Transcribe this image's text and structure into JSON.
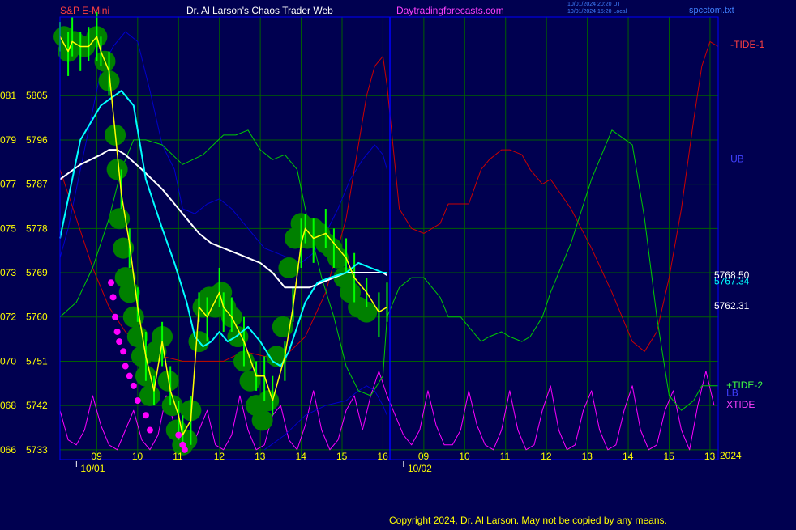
{
  "header": {
    "symbol": "S&P E-Mini",
    "site_title": "Dr. Al Larson's Chaos Trader Web",
    "site_url": "Daytradingforecasts.com",
    "timestamp_ut": "10/01/2024 20:20 UT",
    "timestamp_local": "10/01/2024 15:20 Local",
    "filename": "spcctom.txt"
  },
  "footer": {
    "copyright": "Copyright 2024, Dr. Al Larson. May not be copied by any means."
  },
  "colors": {
    "background": "#000050",
    "frame": "#0000ff",
    "grid": "#006000",
    "price_bar": "#00ff00",
    "event_bubble": "#008000",
    "fast_ma": "#ffff00",
    "medium_ma": "#00ffff",
    "slow_ma": "#ffffff",
    "tide1": "#cc0000",
    "tide2": "#00cc00",
    "ub": "#0000cc",
    "xtide": "#ff00ff",
    "axis_text": "#ffff00"
  },
  "chart_data": {
    "type": "line",
    "title": "S&P E-Mini",
    "y_labels": [
      {
        "left": "081",
        "price": "5805"
      },
      {
        "left": "079",
        "price": "5796"
      },
      {
        "left": "077",
        "price": "5787"
      },
      {
        "left": "075",
        "price": "5778"
      },
      {
        "left": "073",
        "price": "5769"
      },
      {
        "left": "072",
        "price": "5760"
      },
      {
        "left": "070",
        "price": "5751"
      },
      {
        "left": "068",
        "price": "5742"
      },
      {
        "left": "066",
        "price": "5733"
      }
    ],
    "ylim": [
      5731,
      5821
    ],
    "x_ticks": [
      "09",
      "10",
      "11",
      "12",
      "13",
      "14",
      "15",
      "16",
      "09",
      "10",
      "11",
      "12",
      "13",
      "14",
      "15",
      "13"
    ],
    "x_tick_positions": [
      8.9,
      9.9,
      10.9,
      11.9,
      12.9,
      13.9,
      14.9,
      15.9,
      16.9,
      17.9,
      18.9,
      19.9,
      20.9,
      21.9,
      22.9,
      23.9
    ],
    "xlim": [
      8,
      24.1
    ],
    "date_labels": [
      {
        "label": "10/01",
        "x": 8.8
      },
      {
        "label": "10/02",
        "x": 16.8
      }
    ],
    "year_label": "2024",
    "right_labels": [
      {
        "text": "-TIDE-1",
        "color": "#ff4040",
        "x": 24.4,
        "y": 5815.4
      },
      {
        "text": "UB",
        "color": "#4040ff",
        "x": 24.4,
        "y": 5792.1
      },
      {
        "text": "5768.50",
        "color": "#ffffff",
        "x": 24.0,
        "y": 5768.5
      },
      {
        "text": "5767.34",
        "color": "#00ffff",
        "x": 24.0,
        "y": 5767.3
      },
      {
        "text": "5762.31",
        "color": "#ffffff",
        "x": 24.0,
        "y": 5762.3
      },
      {
        "text": "+TIDE-2",
        "color": "#40ff40",
        "x": 24.3,
        "y": 5746.1
      },
      {
        "text": "LB",
        "color": "#4040ff",
        "x": 24.3,
        "y": 5744.6
      },
      {
        "text": "XTIDE",
        "color": "#ff40ff",
        "x": 24.3,
        "y": 5742.2
      }
    ],
    "series": [
      {
        "name": "price",
        "color": "#ffff00",
        "x": [
          8.0,
          8.2,
          8.3,
          8.5,
          8.7,
          8.9,
          9.0,
          9.2,
          9.5,
          9.7,
          9.9,
          10.1,
          10.3,
          10.5,
          10.7,
          10.9,
          11.0,
          11.2,
          11.4,
          11.6,
          11.9,
          12.0,
          12.2,
          12.5,
          12.8,
          13.0,
          13.2,
          13.5,
          13.7,
          13.9,
          14.0,
          14.2,
          14.5,
          14.7,
          15.0,
          15.2,
          15.5,
          15.8,
          16.0
        ],
        "values": [
          5817,
          5814,
          5816,
          5815,
          5815,
          5817,
          5814,
          5810,
          5785,
          5775,
          5762,
          5752,
          5745,
          5755,
          5745,
          5740,
          5736,
          5739,
          5762,
          5760,
          5765,
          5762,
          5760,
          5755,
          5748,
          5748,
          5743,
          5752,
          5762,
          5775,
          5778,
          5776,
          5777,
          5775,
          5772,
          5768,
          5765,
          5761,
          5762
        ]
      },
      {
        "name": "medium",
        "color": "#00ffff",
        "x": [
          8.0,
          8.5,
          9.0,
          9.5,
          9.8,
          10.1,
          10.5,
          10.8,
          11.1,
          11.3,
          11.5,
          11.7,
          11.9,
          12.1,
          12.3,
          12.6,
          12.9,
          13.2,
          13.4,
          13.6,
          13.8,
          14.0,
          14.3,
          14.6,
          15.0,
          15.3,
          15.6,
          15.9,
          16.0
        ],
        "values": [
          5776,
          5796,
          5803,
          5806,
          5803,
          5788,
          5778,
          5771,
          5763,
          5756,
          5754,
          5755,
          5757,
          5755,
          5756,
          5758,
          5755,
          5751,
          5750,
          5753,
          5758,
          5763,
          5767,
          5768,
          5769,
          5771,
          5770,
          5769,
          5769
        ]
      },
      {
        "name": "slow",
        "color": "#ffffff",
        "x": [
          8.0,
          8.5,
          9.0,
          9.2,
          9.4,
          9.6,
          10.0,
          10.5,
          11.0,
          11.2,
          11.4,
          11.7,
          12.0,
          12.3,
          12.6,
          12.9,
          13.2,
          13.5,
          13.8,
          14.1,
          14.4,
          14.7,
          15.0,
          15.3,
          15.6,
          15.9,
          16.0
        ],
        "values": [
          5788,
          5791,
          5793,
          5794,
          5794,
          5793,
          5790,
          5786,
          5781,
          5779,
          5777,
          5775,
          5774,
          5773,
          5772,
          5771,
          5769,
          5766,
          5766,
          5766,
          5767,
          5768,
          5769,
          5769,
          5769,
          5769,
          5768.5
        ]
      },
      {
        "name": "tide1",
        "color": "#cc0000",
        "x": [
          8.0,
          8.4,
          8.8,
          9.2,
          9.6,
          10.0,
          10.5,
          11.0,
          11.5,
          12.0,
          12.5,
          13.0,
          13.5,
          14.0,
          14.5,
          15.0,
          15.3,
          15.5,
          15.7,
          15.9,
          16.0,
          16.3,
          16.6,
          16.9,
          17.1,
          17.3,
          17.5,
          17.8,
          18.0,
          18.3,
          18.5,
          18.8,
          19.0,
          19.3,
          19.5,
          19.8,
          20.0,
          20.5,
          21.0,
          21.5,
          22.0,
          22.3,
          22.6,
          22.9,
          23.2,
          23.5,
          23.7,
          23.9,
          24.1
        ],
        "values": [
          5790,
          5780,
          5770,
          5762,
          5757,
          5754,
          5752,
          5751,
          5751,
          5751,
          5753,
          5752,
          5752,
          5756,
          5765,
          5780,
          5795,
          5805,
          5811,
          5813,
          5807,
          5782,
          5778,
          5777,
          5778,
          5779,
          5783,
          5783,
          5783,
          5790,
          5792,
          5794,
          5794,
          5793,
          5790,
          5787,
          5788,
          5782,
          5774,
          5765,
          5755,
          5753,
          5757,
          5768,
          5782,
          5800,
          5811,
          5816,
          5815
        ]
      },
      {
        "name": "tide2",
        "color": "#00cc00",
        "x": [
          8.0,
          8.4,
          8.8,
          9.2,
          9.5,
          9.8,
          10.1,
          10.5,
          11.0,
          11.5,
          12.0,
          12.3,
          12.6,
          12.9,
          13.2,
          13.5,
          13.8,
          14.1,
          14.4,
          14.7,
          15.0,
          15.3,
          15.6,
          15.9,
          16.0,
          16.3,
          16.6,
          16.9,
          17.1,
          17.3,
          17.5,
          17.8,
          18.0,
          18.3,
          18.5,
          18.8,
          19.0,
          19.3,
          19.5,
          19.8,
          20.0,
          20.5,
          21.0,
          21.5,
          22.0,
          22.3,
          22.6,
          22.9,
          23.2,
          23.5,
          23.7,
          23.9,
          24.1
        ],
        "values": [
          5760,
          5763,
          5770,
          5780,
          5790,
          5796,
          5796,
          5795,
          5791,
          5793,
          5797,
          5797,
          5798,
          5794,
          5792,
          5793,
          5790,
          5778,
          5768,
          5760,
          5750,
          5745,
          5744,
          5748,
          5760,
          5766,
          5768,
          5768,
          5766,
          5764,
          5760,
          5760,
          5758,
          5755,
          5756,
          5757,
          5756,
          5755,
          5756,
          5760,
          5765,
          5775,
          5788,
          5798,
          5795,
          5780,
          5760,
          5744,
          5741,
          5743,
          5746,
          5746,
          5746
        ]
      },
      {
        "name": "ub",
        "color": "#0000cc",
        "x": [
          8.0,
          8.2,
          8.5,
          8.8,
          9.0,
          9.3,
          9.6,
          9.9,
          10.2,
          10.5,
          10.8,
          11.0,
          11.3,
          11.6,
          11.9,
          12.2,
          12.5,
          12.8,
          13.0,
          13.3,
          13.6,
          13.9,
          14.2,
          14.5,
          14.8,
          15.1,
          15.4,
          15.7,
          15.9,
          16.0
        ],
        "values": [
          5772,
          5778,
          5790,
          5802,
          5810,
          5815,
          5818,
          5816,
          5806,
          5795,
          5790,
          5782,
          5781,
          5783,
          5784,
          5782,
          5779,
          5776,
          5774,
          5773,
          5772,
          5771,
          5773,
          5777,
          5782,
          5788,
          5792,
          5795,
          5793,
          5790
        ]
      },
      {
        "name": "lb",
        "color": "#0000cc",
        "x": [
          13.0,
          13.5,
          14.0,
          14.5,
          15.0,
          15.3,
          15.5,
          15.7,
          15.9,
          16.0
        ],
        "values": [
          5733,
          5736,
          5740,
          5742,
          5743,
          5745,
          5746,
          5745,
          5742,
          5740
        ]
      },
      {
        "name": "xtide",
        "color": "#ff00ff",
        "x": [
          8.0,
          8.2,
          8.4,
          8.6,
          8.8,
          9.0,
          9.2,
          9.4,
          9.6,
          9.8,
          10.0,
          10.2,
          10.4,
          10.6,
          10.8,
          11.0,
          11.2,
          11.4,
          11.6,
          11.8,
          12.0,
          12.2,
          12.4,
          12.6,
          12.8,
          13.0,
          13.2,
          13.4,
          13.6,
          13.8,
          14.0,
          14.2,
          14.4,
          14.6,
          14.8,
          15.0,
          15.2,
          15.4,
          15.6,
          15.8,
          16.0,
          16.2,
          16.4,
          16.6,
          16.8,
          17.0,
          17.2,
          17.4,
          17.6,
          17.8,
          18.0,
          18.2,
          18.4,
          18.6,
          18.8,
          19.0,
          19.2,
          19.4,
          19.6,
          19.8,
          20.0,
          20.2,
          20.4,
          20.6,
          20.8,
          21.0,
          21.2,
          21.4,
          21.6,
          21.8,
          22.0,
          22.2,
          22.4,
          22.6,
          22.8,
          23.0,
          23.2,
          23.4,
          23.6,
          23.8,
          24.0
        ],
        "values": [
          5741,
          5735,
          5734,
          5737,
          5744,
          5738,
          5734,
          5733,
          5737,
          5741,
          5735,
          5733,
          5736,
          5744,
          5738,
          5734,
          5733,
          5737,
          5741,
          5734,
          5733,
          5736,
          5744,
          5737,
          5733,
          5734,
          5740,
          5742,
          5735,
          5733,
          5738,
          5745,
          5737,
          5733,
          5735,
          5741,
          5744,
          5737,
          5744,
          5749,
          5744,
          5740,
          5736,
          5734,
          5737,
          5745,
          5738,
          5734,
          5734,
          5737,
          5745,
          5738,
          5734,
          5733,
          5737,
          5745,
          5737,
          5733,
          5734,
          5741,
          5746,
          5737,
          5733,
          5734,
          5741,
          5745,
          5737,
          5733,
          5734,
          5741,
          5746,
          5737,
          5733,
          5734,
          5741,
          5745,
          5737,
          5733,
          5742,
          5749,
          5742
        ]
      }
    ],
    "events": [
      {
        "x": 8.1,
        "y": 5817
      },
      {
        "x": 8.2,
        "y": 5814
      },
      {
        "x": 8.35,
        "y": 5816
      },
      {
        "x": 8.6,
        "y": 5815
      },
      {
        "x": 8.9,
        "y": 5817
      },
      {
        "x": 9.1,
        "y": 5812
      },
      {
        "x": 9.2,
        "y": 5808
      },
      {
        "x": 9.35,
        "y": 5797
      },
      {
        "x": 9.4,
        "y": 5790
      },
      {
        "x": 9.45,
        "y": 5780
      },
      {
        "x": 9.55,
        "y": 5774
      },
      {
        "x": 9.6,
        "y": 5768
      },
      {
        "x": 9.7,
        "y": 5765
      },
      {
        "x": 9.8,
        "y": 5760
      },
      {
        "x": 9.9,
        "y": 5756
      },
      {
        "x": 10.0,
        "y": 5752
      },
      {
        "x": 10.1,
        "y": 5748
      },
      {
        "x": 10.2,
        "y": 5744
      },
      {
        "x": 10.35,
        "y": 5753
      },
      {
        "x": 10.5,
        "y": 5756
      },
      {
        "x": 10.65,
        "y": 5747
      },
      {
        "x": 10.75,
        "y": 5742
      },
      {
        "x": 10.85,
        "y": 5737
      },
      {
        "x": 11.0,
        "y": 5734
      },
      {
        "x": 11.1,
        "y": 5735
      },
      {
        "x": 11.2,
        "y": 5741
      },
      {
        "x": 11.4,
        "y": 5755
      },
      {
        "x": 11.5,
        "y": 5762
      },
      {
        "x": 11.65,
        "y": 5764
      },
      {
        "x": 11.8,
        "y": 5762
      },
      {
        "x": 11.95,
        "y": 5765
      },
      {
        "x": 12.05,
        "y": 5762
      },
      {
        "x": 12.2,
        "y": 5760
      },
      {
        "x": 12.35,
        "y": 5756
      },
      {
        "x": 12.5,
        "y": 5751
      },
      {
        "x": 12.65,
        "y": 5747
      },
      {
        "x": 12.8,
        "y": 5742
      },
      {
        "x": 12.95,
        "y": 5739
      },
      {
        "x": 13.1,
        "y": 5743
      },
      {
        "x": 13.3,
        "y": 5752
      },
      {
        "x": 13.45,
        "y": 5758
      },
      {
        "x": 13.6,
        "y": 5770
      },
      {
        "x": 13.75,
        "y": 5776
      },
      {
        "x": 13.9,
        "y": 5779
      },
      {
        "x": 14.05,
        "y": 5776
      },
      {
        "x": 14.2,
        "y": 5778
      },
      {
        "x": 14.35,
        "y": 5777
      },
      {
        "x": 14.5,
        "y": 5775
      },
      {
        "x": 14.65,
        "y": 5774
      },
      {
        "x": 14.8,
        "y": 5772
      },
      {
        "x": 14.95,
        "y": 5768
      },
      {
        "x": 15.1,
        "y": 5765
      },
      {
        "x": 15.3,
        "y": 5762
      },
      {
        "x": 15.5,
        "y": 5761
      }
    ],
    "markers": [
      {
        "x": 9.25,
        "y": 5767
      },
      {
        "x": 9.3,
        "y": 5764
      },
      {
        "x": 9.35,
        "y": 5760
      },
      {
        "x": 9.4,
        "y": 5757
      },
      {
        "x": 9.45,
        "y": 5755
      },
      {
        "x": 9.55,
        "y": 5753
      },
      {
        "x": 9.6,
        "y": 5750
      },
      {
        "x": 9.7,
        "y": 5748
      },
      {
        "x": 9.8,
        "y": 5746
      },
      {
        "x": 9.9,
        "y": 5743
      },
      {
        "x": 10.1,
        "y": 5740
      },
      {
        "x": 10.2,
        "y": 5737
      },
      {
        "x": 10.9,
        "y": 5736
      },
      {
        "x": 11.0,
        "y": 5734
      },
      {
        "x": 11.05,
        "y": 5733
      }
    ]
  }
}
